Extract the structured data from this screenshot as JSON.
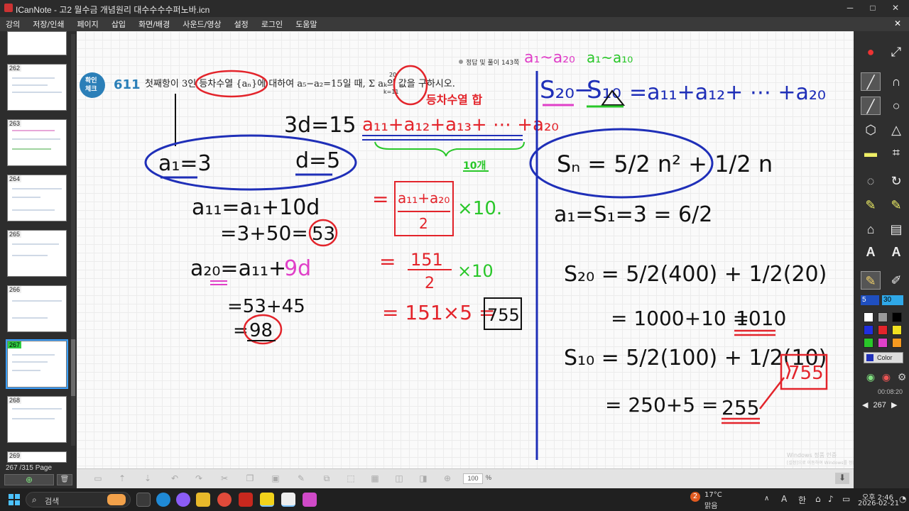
{
  "window": {
    "title": "ICanNote - 고2 월수금 개념원리 대수수수수퍼노바.icn",
    "controls": [
      "─",
      "□",
      "✕"
    ]
  },
  "menu": [
    "강의",
    "저장/인쇄",
    "페이지",
    "삽입",
    "화면/배경",
    "사운드/영상",
    "설정",
    "로그인",
    "도움말"
  ],
  "thumbnails": {
    "pages": [
      "262",
      "263",
      "264",
      "265",
      "266",
      "267",
      "268",
      "269"
    ],
    "active_page": "267",
    "page_count_label": "267 /315 Page"
  },
  "worksheet": {
    "badge_line1": "확인",
    "badge_line2": "체크",
    "problem_number": "611",
    "problem_text": "첫째항이 3인 등차수열 {aₙ}에 대하여 a₅−a₂=15일 때, Σ aₖ의 값을 구하시오.",
    "sum_top": "20",
    "sum_bottom": "k=11",
    "answer_ref": "정답 및 풀이 143쪽"
  },
  "handwriting": {
    "top_pink": "a₁~a₂₀",
    "top_green": "a₁~a₁₀",
    "red_title": "등차수열 합",
    "three_d": "3d=15",
    "a1_eq": "a₁=3",
    "d_eq": "d=5",
    "sum_red": "a₁₁+a₁₂+a₁₃+ ⋯ +a₂₀",
    "ten_terms": "10개",
    "a11_line1": "a₁₁=a₁+10d",
    "a11_line2": "=3+50=",
    "a11_value": "53",
    "a20_line1_a": "a₂₀=a₁₁+",
    "a20_line1_b": "9d",
    "a20_line2": "=53+45",
    "a20_line3": "=",
    "a20_value": "98",
    "frac_num": "a₁₁+a₂₀",
    "frac_den": "2",
    "times10_green": "×10.",
    "eq1": "=",
    "frac2_num": "151",
    "frac2_den": "2",
    "times10_2": "×10",
    "eq2": "=",
    "line3": "= 151×5 =",
    "result_box": "755",
    "right_title_a": "S₂₀",
    "right_title_b": "−",
    "right_title_c": "S₁₀",
    "right_title_d": "=a₁₁+a₁₂+ ⋯ +a₂₀",
    "sn_formula": "Sₙ = 5/2 n² + 1/2 n",
    "s1_line": "a₁=S₁=3 = 6/2",
    "s20_line1": "S₂₀ = 5/2(400) + 1/2(20)",
    "s20_line2": "= 1000+10 =",
    "s20_value": "1010",
    "s10_line1": "S₁₀ = 5/2(100) + 1/2(10)",
    "s10_line2": "= 250+5 =",
    "s10_value": "255",
    "right_box": "755"
  },
  "canvas_toolbar": {
    "zoom": "100",
    "zoom_unit": "%"
  },
  "tools": {
    "pen_size": "5",
    "eraser_size": "30",
    "color_label": "Color",
    "timer": "00:08:20",
    "page_indicator": "267"
  },
  "colors": {
    "red": "#e3242b",
    "blue": "#1f2fb8",
    "pink": "#e040c8",
    "green": "#29c729",
    "black": "#111111"
  },
  "watermark": {
    "line1": "Windows 정품 인증",
    "line2": "[설정]으로 이동하여 Windows를 정품 인증합니다."
  },
  "taskbar": {
    "search_placeholder": "검색",
    "weather_temp": "17°C",
    "weather_desc": "맑음",
    "ime_a": "A",
    "ime_han": "한",
    "time": "오후 2:46",
    "date": "2026-02-21",
    "notif_count": "2"
  }
}
